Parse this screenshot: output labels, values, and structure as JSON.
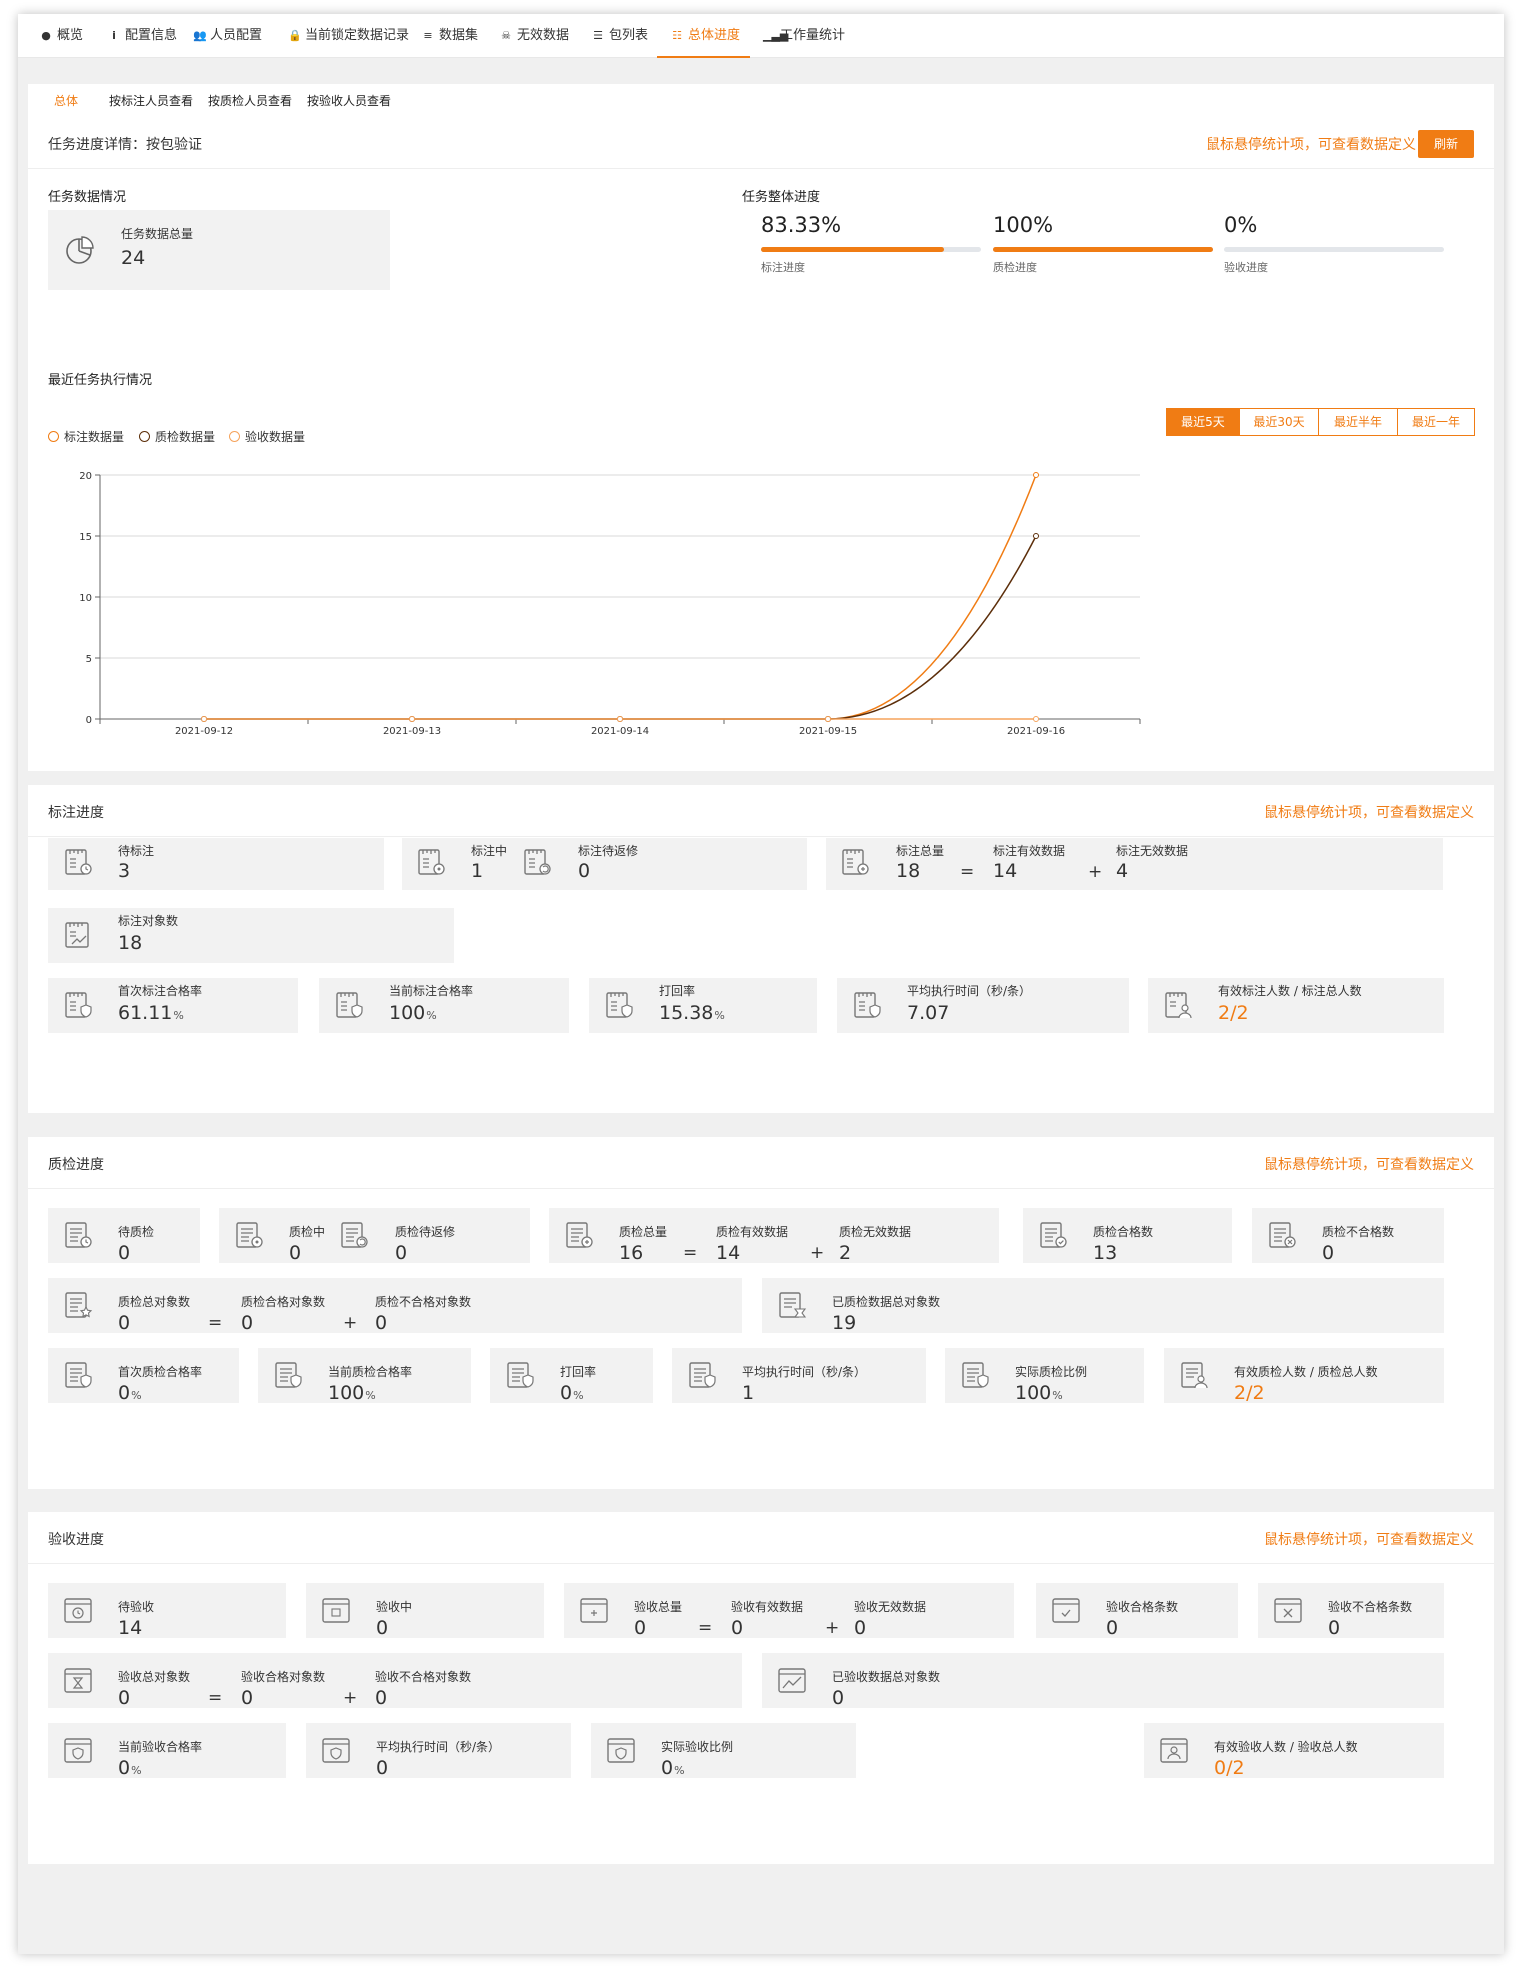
{
  "top_tabs": [
    {
      "label": "概览",
      "icon": "clock-icon"
    },
    {
      "label": "配置信息",
      "icon": "info-icon"
    },
    {
      "label": "人员配置",
      "icon": "users-icon"
    },
    {
      "label": "当前锁定数据记录",
      "icon": "lock-icon"
    },
    {
      "label": "数据集",
      "icon": "database-icon"
    },
    {
      "label": "无效数据",
      "icon": "skull-icon"
    },
    {
      "label": "包列表",
      "icon": "server-icon"
    },
    {
      "label": "总体进度",
      "icon": "sliders-icon",
      "active": true
    },
    {
      "label": "工作量统计",
      "icon": "signal-icon"
    }
  ],
  "sub_tabs": [
    {
      "label": "总体",
      "active": true
    },
    {
      "label": "按标注人员查看"
    },
    {
      "label": "按质检人员查看"
    },
    {
      "label": "按验收人员查看"
    }
  ],
  "overview": {
    "title": "任务进度详情：按包验证",
    "hint": "鼠标悬停统计项，可查看数据定义",
    "refresh": "刷新",
    "data_section": "任务数据情况",
    "total_label": "任务数据总量",
    "total_value": "24",
    "progress_section": "任务整体进度",
    "progress": [
      {
        "value": "83.33%",
        "fraction": 0.8333,
        "label": "标注进度"
      },
      {
        "value": "100%",
        "fraction": 1.0,
        "label": "质检进度"
      },
      {
        "value": "0%",
        "fraction": 0.0,
        "label": "验收进度"
      }
    ],
    "recent_section": "最近任务执行情况",
    "ranges": [
      {
        "label": "最近5天",
        "active": true
      },
      {
        "label": "最近30天"
      },
      {
        "label": "最近半年"
      },
      {
        "label": "最近一年"
      }
    ]
  },
  "chart_data": {
    "type": "line",
    "x": [
      "2021-09-12",
      "2021-09-13",
      "2021-09-14",
      "2021-09-15",
      "2021-09-16"
    ],
    "ylim": [
      0,
      20
    ],
    "yticks": [
      0,
      5,
      10,
      15,
      20
    ],
    "grid": true,
    "legend_position": "top-left",
    "series": [
      {
        "name": "标注数据量",
        "values": [
          0,
          0,
          0,
          0,
          20
        ],
        "color": "#f07c14"
      },
      {
        "name": "质检数据量",
        "values": [
          0,
          0,
          0,
          0,
          15
        ],
        "color": "#5c2e0a"
      },
      {
        "name": "验收数据量",
        "values": [
          0,
          0,
          0,
          0,
          0
        ],
        "color": "#f5a35c"
      }
    ]
  },
  "annotation": {
    "title": "标注进度",
    "hint": "鼠标悬停统计项，可查看数据定义",
    "pending_label": "待标注",
    "pending_value": "3",
    "in_progress_label": "标注中",
    "in_progress_value": "1",
    "rework_label": "标注待返修",
    "rework_value": "0",
    "total_label": "标注总量",
    "total_value": "18",
    "valid_label": "标注有效数据",
    "valid_value": "14",
    "invalid_label": "标注无效数据",
    "invalid_value": "4",
    "objects_label": "标注对象数",
    "objects_value": "18",
    "first_pass_label": "首次标注合格率",
    "first_pass_value": "61.11",
    "current_pass_label": "当前标注合格率",
    "current_pass_value": "100",
    "return_label": "打回率",
    "return_value": "15.38",
    "avg_time_label": "平均执行时间（秒/条）",
    "avg_time_value": "7.07",
    "people_label": "有效标注人数 / 标注总人数",
    "people_value": "2/2"
  },
  "qc": {
    "title": "质检进度",
    "hint": "鼠标悬停统计项，可查看数据定义",
    "pending_label": "待质检",
    "pending_value": "0",
    "in_progress_label": "质检中",
    "in_progress_value": "0",
    "rework_label": "质检待返修",
    "rework_value": "0",
    "total_label": "质检总量",
    "total_value": "16",
    "valid_label": "质检有效数据",
    "valid_value": "14",
    "invalid_label": "质检无效数据",
    "invalid_value": "2",
    "pass_count_label": "质检合格数",
    "pass_count_value": "13",
    "fail_count_label": "质检不合格数",
    "fail_count_value": "0",
    "obj_total_label": "质检总对象数",
    "obj_total_value": "0",
    "obj_pass_label": "质检合格对象数",
    "obj_pass_value": "0",
    "obj_fail_label": "质检不合格对象数",
    "obj_fail_value": "0",
    "checked_obj_label": "已质检数据总对象数",
    "checked_obj_value": "19",
    "first_pass_label": "首次质检合格率",
    "first_pass_value": "0",
    "current_pass_label": "当前质检合格率",
    "current_pass_value": "100",
    "return_label": "打回率",
    "return_value": "0",
    "avg_time_label": "平均执行时间（秒/条）",
    "avg_time_value": "1",
    "ratio_label": "实际质检比例",
    "ratio_value": "100",
    "people_label": "有效质检人数 / 质检总人数",
    "people_value": "2/2"
  },
  "acceptance": {
    "title": "验收进度",
    "hint": "鼠标悬停统计项，可查看数据定义",
    "pending_label": "待验收",
    "pending_value": "14",
    "in_progress_label": "验收中",
    "in_progress_value": "0",
    "total_label": "验收总量",
    "total_value": "0",
    "valid_label": "验收有效数据",
    "valid_value": "0",
    "invalid_label": "验收无效数据",
    "invalid_value": "0",
    "pass_label": "验收合格条数",
    "pass_value": "0",
    "fail_label": "验收不合格条数",
    "fail_value": "0",
    "obj_total_label": "验收总对象数",
    "obj_total_value": "0",
    "obj_pass_label": "验收合格对象数",
    "obj_pass_value": "0",
    "obj_fail_label": "验收不合格对象数",
    "obj_fail_value": "0",
    "accepted_obj_label": "已验收数据总对象数",
    "accepted_obj_value": "0",
    "current_pass_label": "当前验收合格率",
    "current_pass_value": "0",
    "avg_time_label": "平均执行时间（秒/条）",
    "avg_time_value": "0",
    "ratio_label": "实际验收比例",
    "ratio_value": "0",
    "people_label": "有效验收人数 / 验收总人数",
    "people_value": "0/2"
  },
  "ops": {
    "eq": "=",
    "plus": "+",
    "pct": "%"
  },
  "colors": {
    "accent": "#f07c14",
    "card_bg": "#f2f2f2"
  }
}
